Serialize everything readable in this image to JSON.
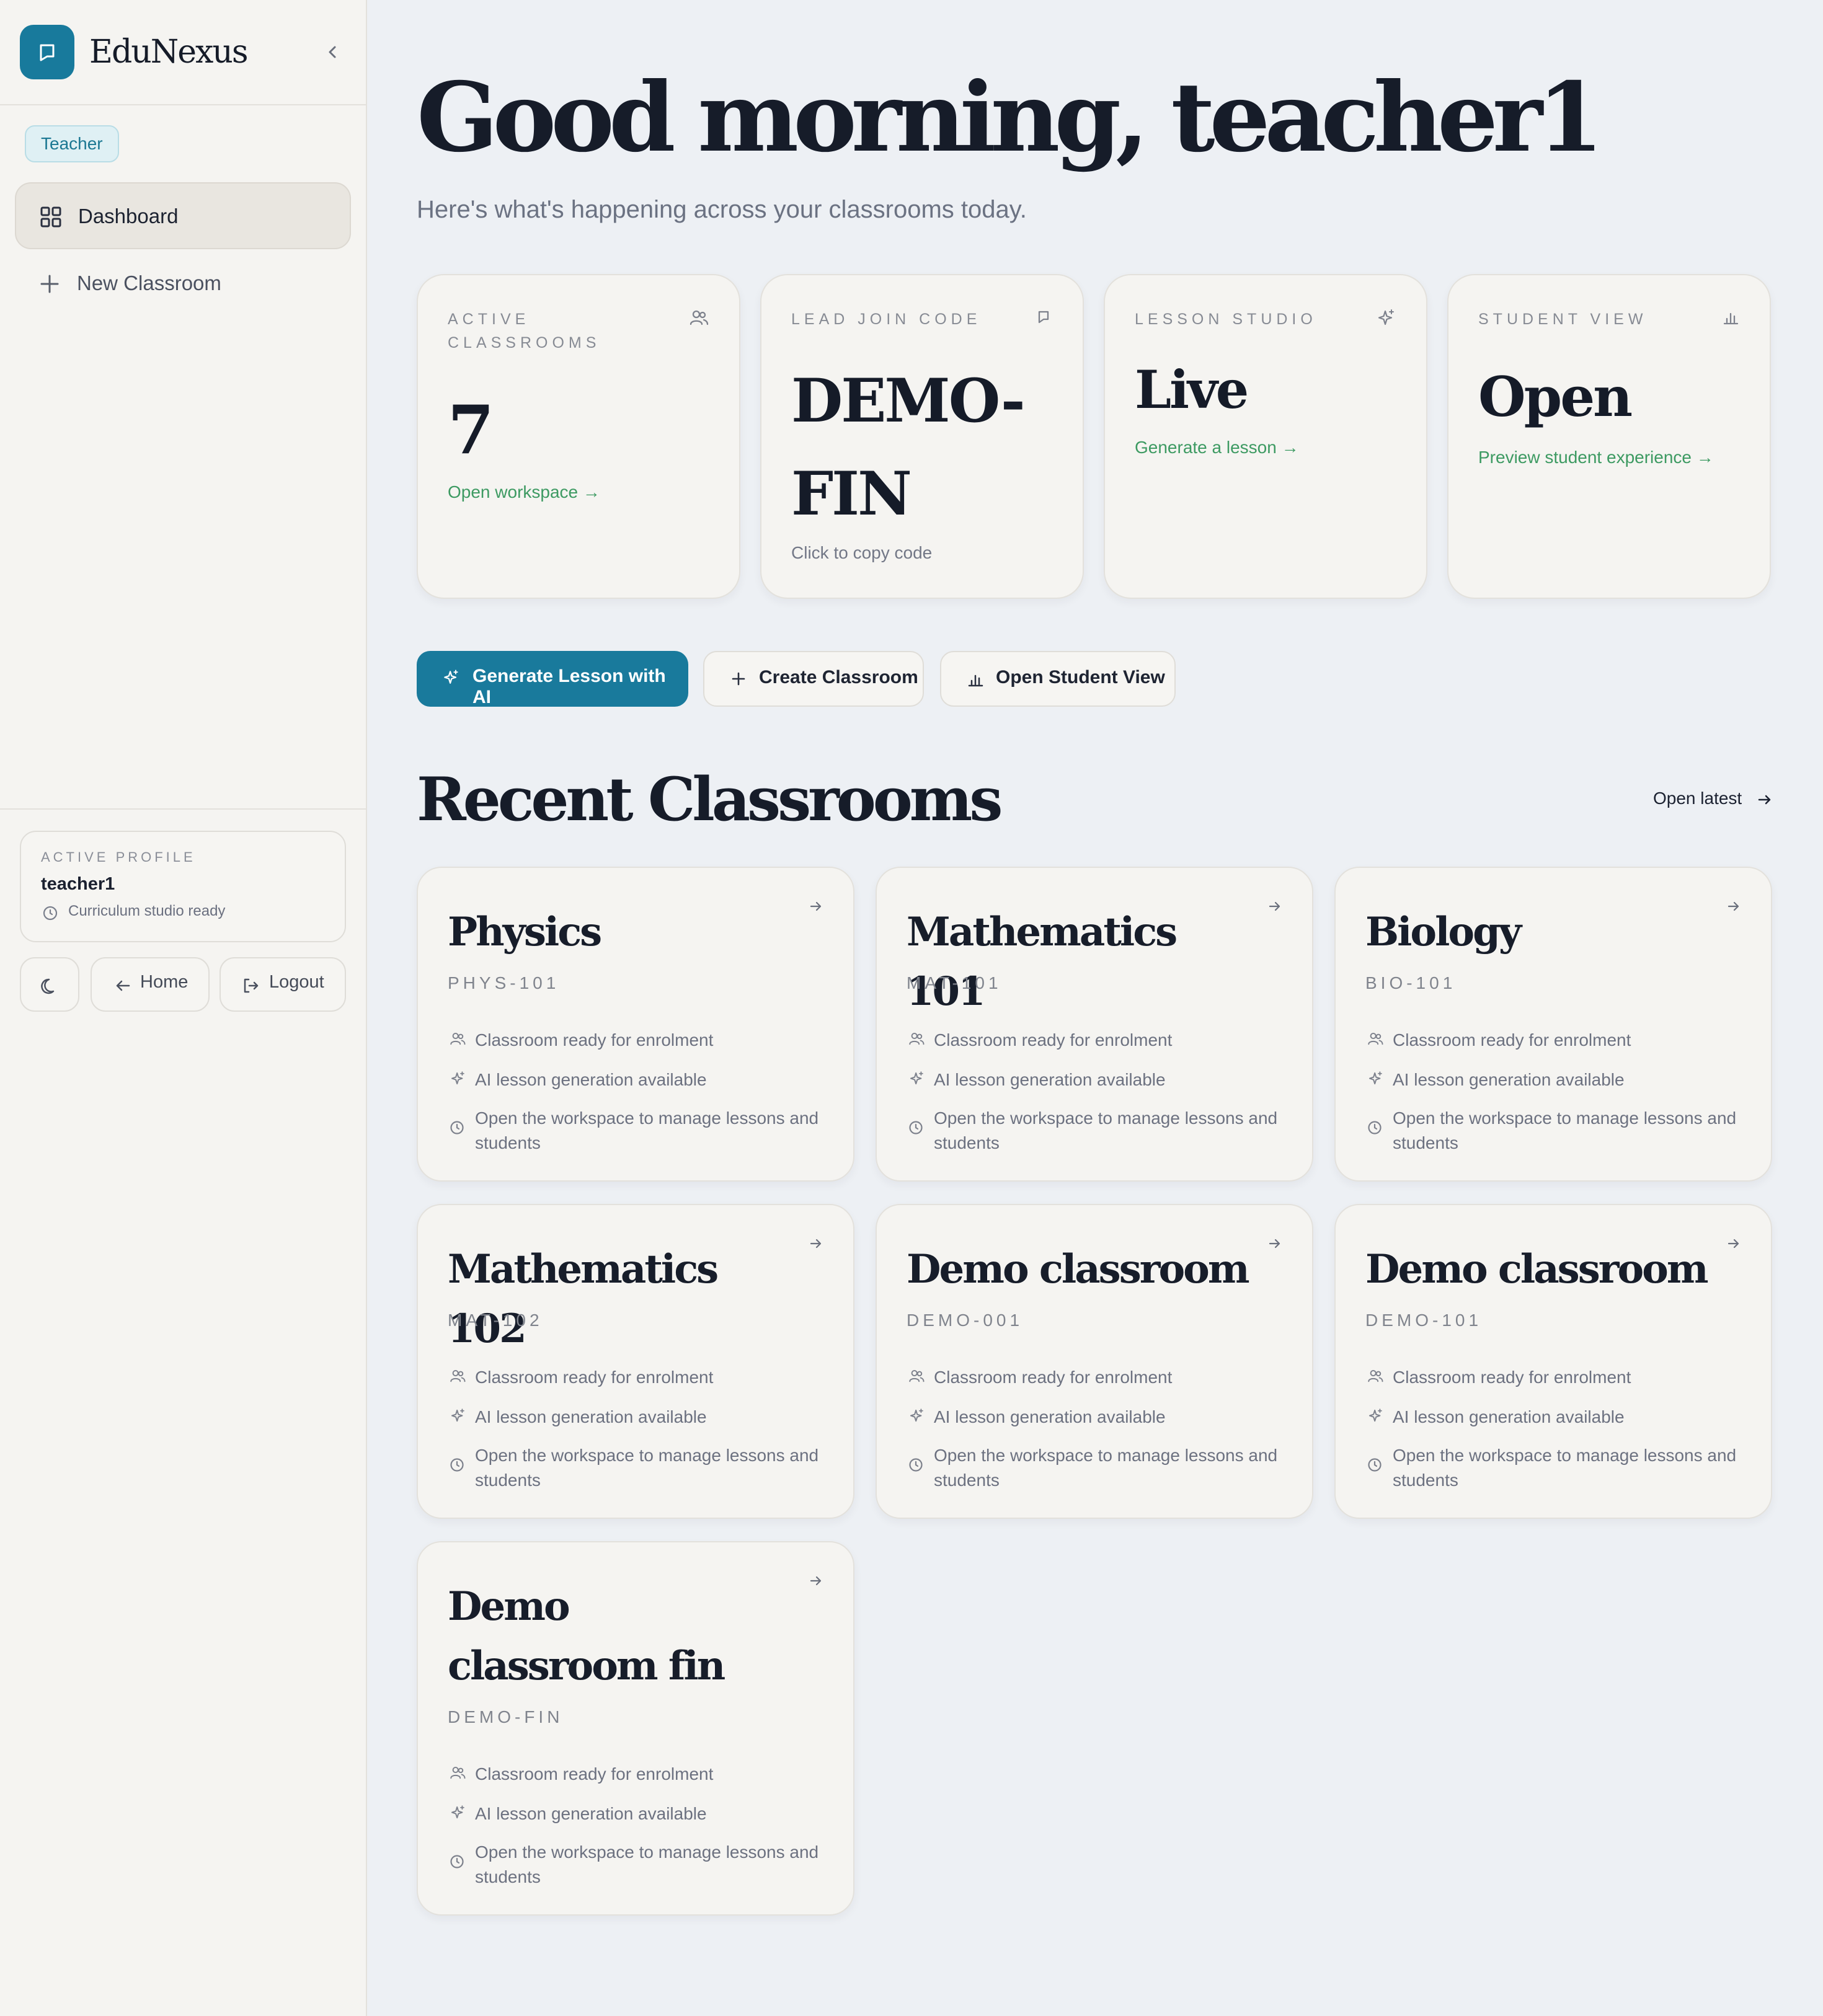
{
  "app": {
    "name": "EduNexus"
  },
  "sidebar": {
    "role_badge": "Teacher",
    "nav": [
      {
        "label": "Dashboard",
        "icon": "grid-icon",
        "active": true
      },
      {
        "label": "New Classroom",
        "icon": "plus-icon",
        "active": false
      }
    ],
    "profile": {
      "label": "ACTIVE PROFILE",
      "name": "teacher1",
      "status": "Curriculum studio ready"
    },
    "buttons": {
      "theme_icon": "moon-icon",
      "home": "Home",
      "logout": "Logout"
    }
  },
  "header": {
    "greeting": "Good morning, teacher1",
    "subtitle": "Here's what's happening across your classrooms today."
  },
  "stats": [
    {
      "label": "ACTIVE CLASSROOMS",
      "value": "7",
      "link": "Open workspace →",
      "icon": "users-icon"
    },
    {
      "label": "LEAD JOIN CODE",
      "value": "DEMO-FIN",
      "hint": "Click to copy code",
      "icon": "chat-icon"
    },
    {
      "label": "LESSON STUDIO",
      "value": "Live",
      "link": "Generate a lesson →",
      "icon": "sparkle-icon"
    },
    {
      "label": "STUDENT VIEW",
      "value": "Open",
      "link": "Preview student experience →",
      "icon": "bar-chart-icon"
    }
  ],
  "actions": {
    "generate": "Generate Lesson with AI",
    "create": "Create Classroom",
    "student_view": "Open Student View"
  },
  "recent": {
    "title": "Recent Classrooms",
    "open_latest": "Open latest",
    "row_enrol": "Classroom ready for enrolment",
    "row_ai": "AI lesson generation available",
    "row_manage": "Open the workspace to manage lessons and students",
    "classrooms": [
      {
        "title": "Physics",
        "code": "PHYS-101"
      },
      {
        "title": "Mathematics 101",
        "code": "MAT-101"
      },
      {
        "title": "Biology",
        "code": "BIO-101"
      },
      {
        "title": "Mathematics 102",
        "code": "MAT-102"
      },
      {
        "title": "Demo classroom",
        "code": "DEMO-001"
      },
      {
        "title": "Demo classroom",
        "code": "DEMO-101"
      },
      {
        "title": "Demo classroom fin",
        "code": "DEMO-FIN"
      }
    ]
  },
  "colors": {
    "brand": "#187a9c",
    "link_green": "#3d9a62",
    "background": "#edf0f4",
    "card": "#f5f4f1"
  }
}
